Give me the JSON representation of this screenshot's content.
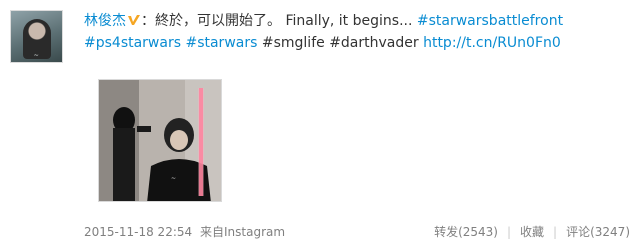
{
  "post": {
    "author": "林俊杰",
    "text_cn": "：終於，可以開始了。",
    "text_en": "Finally, it begins...",
    "hashtags": [
      "#starwarsbattlefront",
      "#ps4starwars",
      "#starwars",
      "#smglife",
      "#darthvader"
    ],
    "link": "http://t.cn/RUn0Fn0",
    "timestamp": "2015-11-18 22:54",
    "source_prefix": "来自",
    "source_app": "Instagram"
  },
  "actions": {
    "repost": "转发(2543)",
    "favorite": "收藏",
    "comment": "评论(3247)"
  },
  "colors": {
    "link": "#0a8cd2",
    "meta": "#808080",
    "verified_badge": "#f5a623"
  },
  "icons": {
    "verified": "verified-v-icon"
  }
}
